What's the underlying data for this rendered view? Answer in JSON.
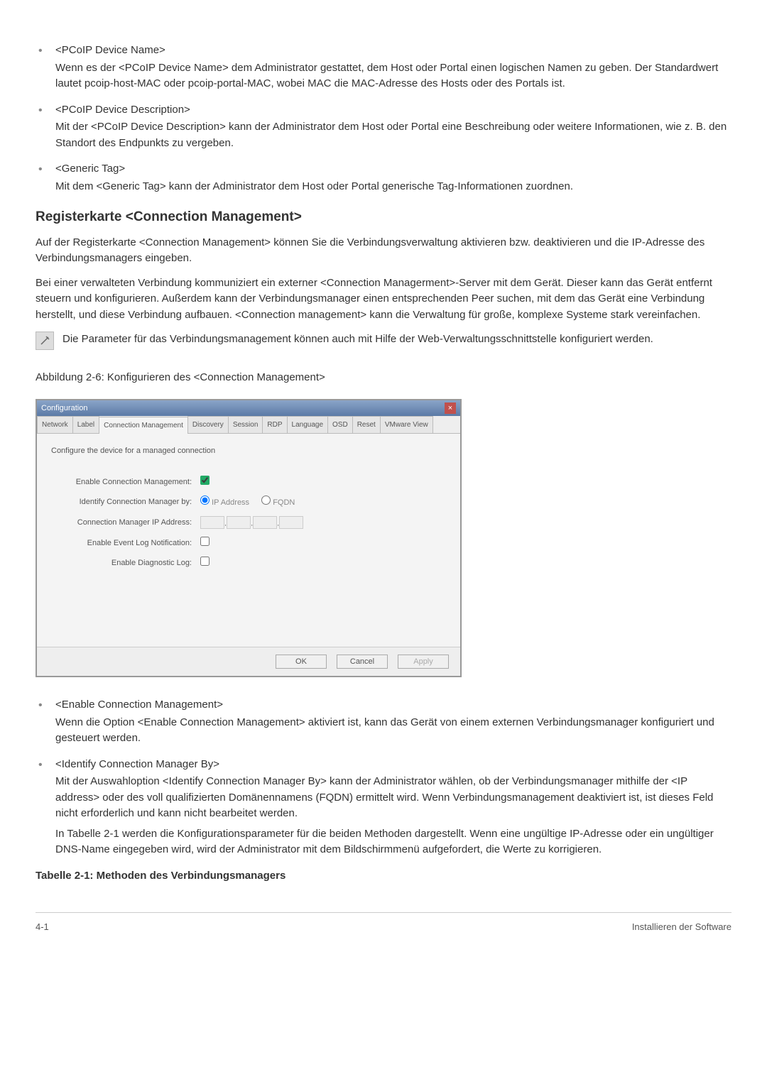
{
  "top_list": [
    {
      "title": "<PCoIP Device Name>",
      "body": "Wenn es der <PCoIP Device Name> dem Administrator gestattet, dem Host oder Portal einen logischen Namen zu geben. Der Standardwert lautet pcoip-host-MAC oder pcoip-portal-MAC, wobei MAC die MAC-Adresse des Hosts oder des Portals ist."
    },
    {
      "title": "<PCoIP Device Description>",
      "body": "Mit der <PCoIP Device Description> kann der Administrator dem Host oder Portal eine Beschreibung oder weitere Informationen, wie z. B. den Standort des Endpunkts zu vergeben."
    },
    {
      "title": "<Generic Tag>",
      "body": "Mit dem <Generic Tag> kann der Administrator dem Host oder Portal generische Tag-Informationen zuordnen."
    }
  ],
  "section_heading": "Registerkarte <Connection Management>",
  "section_paras": [
    "Auf der Registerkarte <Connection Management> können Sie die Verbindungsverwaltung aktivieren bzw. deaktivieren und die IP-Adresse des Verbindungsmanagers eingeben.",
    "Bei einer verwalteten Verbindung kommuniziert ein externer <Connection Managerment>-Server mit dem Gerät. Dieser kann das Gerät entfernt steuern und konfigurieren. Außerdem kann der Verbindungsmanager einen entsprechenden Peer suchen, mit dem das Gerät eine Verbindung herstellt, und diese Verbindung aufbauen. <Connection management> kann die Verwaltung für große, komplexe Systeme stark vereinfachen."
  ],
  "note_text": "Die Parameter für das Verbindungsmanagement können auch mit Hilfe der Web-Verwaltungsschnittstelle konfiguriert werden.",
  "figure_caption": "Abbildung 2-6: Konfigurieren des <Connection Management>",
  "dialog": {
    "title": "Configuration",
    "tabs": [
      "Network",
      "Label",
      "Connection Management",
      "Discovery",
      "Session",
      "RDP",
      "Language",
      "OSD",
      "Reset",
      "VMware View"
    ],
    "active_tab_index": 2,
    "intro": "Configure the device for a managed connection",
    "labels": {
      "enable_cm": "Enable Connection Management:",
      "identify_by": "Identify Connection Manager by:",
      "ip_address": "Connection Manager IP Address:",
      "event_log": "Enable Event Log Notification:",
      "diag_log": "Enable Diagnostic Log:"
    },
    "radios": {
      "ip": "IP Address",
      "fqdn": "FQDN"
    },
    "buttons": {
      "ok": "OK",
      "cancel": "Cancel",
      "apply": "Apply"
    }
  },
  "bottom_list": [
    {
      "title": "<Enable Connection Management>",
      "body": "Wenn die Option <Enable Connection Management> aktiviert ist, kann das Gerät von einem externen Verbindungsmanager konfiguriert und gesteuert werden."
    },
    {
      "title": "<Identify Connection Manager By>",
      "body": "Mit der Auswahloption <Identify Connection Manager By> kann der Administrator wählen, ob der Verbindungsmanager mithilfe der <IP address> oder des voll qualifizierten Domänennamens (FQDN) ermittelt wird. Wenn Verbindungsmanagement deaktiviert ist, ist dieses Feld nicht erforderlich und kann nicht bearbeitet werden.",
      "body2": "In Tabelle 2-1 werden die Konfigurationsparameter für die beiden Methoden dargestellt. Wenn eine ungültige IP-Adresse oder ein ungültiger DNS-Name eingegeben wird, wird der Administrator mit dem Bildschirmmenü aufgefordert, die Werte zu korrigieren."
    }
  ],
  "table_heading": "Tabelle 2-1: Methoden des Verbindungsmanagers",
  "footer": {
    "left": "4-1",
    "right": "Installieren der Software"
  }
}
